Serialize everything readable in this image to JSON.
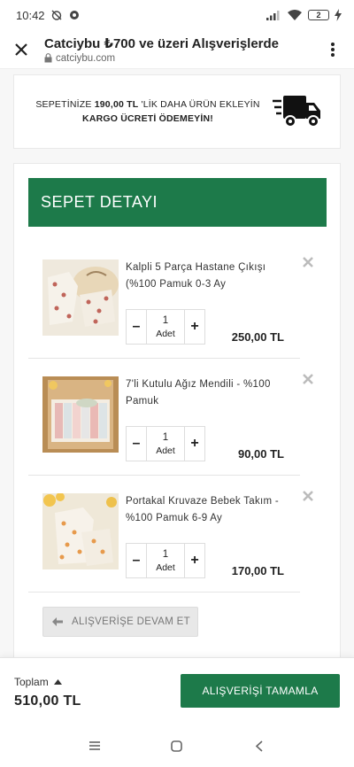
{
  "status_bar": {
    "time": "10:42",
    "battery_level": "2"
  },
  "browser": {
    "title": "Catciybu ₺700 ve üzeri Alışverişlerde",
    "url": "catciybu.com"
  },
  "shipping_notice": {
    "prefix": "SEPETİNİZE ",
    "amount": "190,00 TL",
    "middle": " 'LİK DAHA ÜRÜN EKLEYİN",
    "suffix": "KARGO ÜCRETİ ÖDEMEYİN!"
  },
  "cart": {
    "header": "SEPET DETAYI",
    "items": [
      {
        "name": "Kalpli 5 Parça Hastane Çıkışı (%100 Pamuk 0-3 Ay",
        "quantity": "1",
        "unit": "Adet",
        "price": "250,00 TL"
      },
      {
        "name": "7'li Kutulu Ağız Mendili - %100 Pamuk",
        "quantity": "1",
        "unit": "Adet",
        "price": "90,00 TL"
      },
      {
        "name": "Portakal Kruvaze Bebek Takım - %100 Pamuk 6-9 Ay",
        "quantity": "1",
        "unit": "Adet",
        "price": "170,00 TL"
      }
    ],
    "continue_label": "ALIŞVERİŞE DEVAM ET"
  },
  "footer": {
    "total_label": "Toplam",
    "total_amount": "510,00 TL",
    "checkout_label": "ALIŞVERİŞİ TAMAMLA"
  },
  "colors": {
    "accent": "#1d7a4a"
  }
}
